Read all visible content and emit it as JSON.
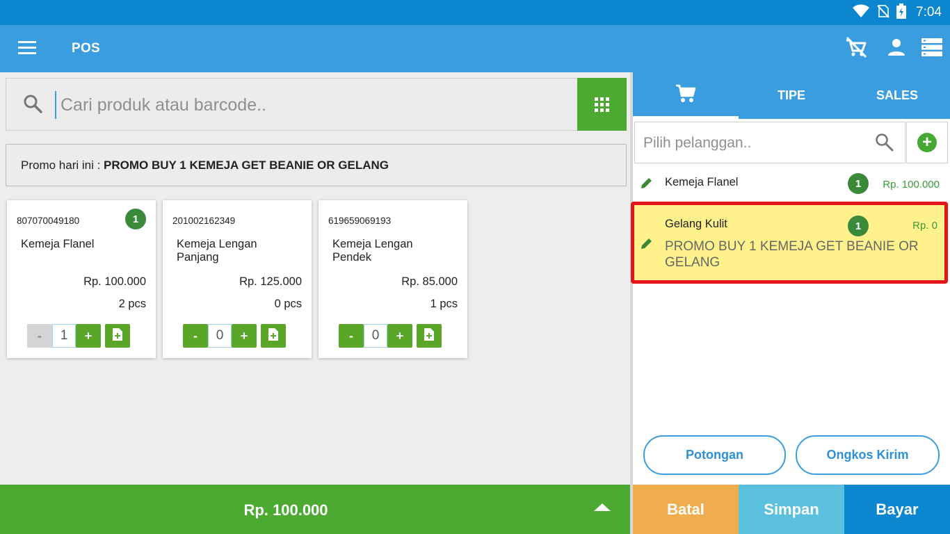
{
  "status_bar": {
    "time": "7:04"
  },
  "app_bar": {
    "title": "POS"
  },
  "search": {
    "placeholder": "Cari produk atau barcode.."
  },
  "promo": {
    "prefix": "Promo hari ini : ",
    "name": "PROMO BUY 1 KEMEJA GET BEANIE OR GELANG"
  },
  "products": [
    {
      "barcode": "807070049180",
      "name": "Kemeja Flanel",
      "price": "Rp. 100.000",
      "stock": "2 pcs",
      "qty": "1",
      "badge": "1",
      "minus": "-",
      "plus": "+"
    },
    {
      "barcode": "201002162349",
      "name": "Kemeja Lengan Panjang",
      "price": "Rp. 125.000",
      "stock": "0 pcs",
      "qty": "0",
      "minus": "-",
      "plus": "+"
    },
    {
      "barcode": "619659069193",
      "name": "Kemeja Lengan Pendek",
      "price": "Rp. 85.000",
      "stock": "1 pcs",
      "qty": "0",
      "minus": "-",
      "plus": "+"
    }
  ],
  "total": {
    "amount": "Rp. 100.000"
  },
  "tabs": {
    "cart_icon": "cart-icon",
    "tipe": "TIPE",
    "sales": "SALES"
  },
  "customer": {
    "placeholder": "Pilih pelanggan.."
  },
  "order_items": [
    {
      "name": "Kemeja Flanel",
      "qty": "1",
      "price": "Rp. 100.000"
    },
    {
      "name": "Gelang Kulit",
      "qty": "1",
      "price": "Rp. 0",
      "promo": "PROMO BUY 1 KEMEJA GET BEANIE OR GELANG"
    }
  ],
  "buttons": {
    "potongan": "Potongan",
    "ongkos_kirim": "Ongkos Kirim",
    "batal": "Batal",
    "simpan": "Simpan",
    "bayar": "Bayar"
  },
  "colors": {
    "status_bar": "#0b86cf",
    "app_bar": "#3a9de0",
    "green": "#4caa32",
    "batal": "#f0ad4e",
    "simpan": "#5bc0de",
    "bayar": "#0b86cf",
    "highlight_border": "#e5141b",
    "highlight_fill": "#fff28c"
  }
}
